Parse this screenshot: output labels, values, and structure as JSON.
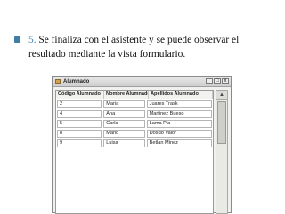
{
  "slide": {
    "step_number": "5.",
    "text": " Se finaliza con el asistente y se puede observar el resultado mediante la vista formulario."
  },
  "window": {
    "title": "Alumnado",
    "buttons": {
      "minimize": "_",
      "maximize": "□",
      "close": "x"
    }
  },
  "grid": {
    "headers": [
      "Código Alumnado",
      "Nombre Alumnado",
      "Apellidos Alumnado"
    ],
    "rows": [
      [
        "2",
        "Maria",
        "Juares Trask"
      ],
      [
        "4",
        "Ana",
        "Martinez Bueso"
      ],
      [
        "5",
        "Carla",
        "Lama Pla"
      ],
      [
        "8",
        "Mario",
        "Dosdo Valor"
      ],
      [
        "9",
        "Luisa",
        "Betlan Minez"
      ]
    ]
  },
  "scrollbar": {
    "up": "▲"
  }
}
